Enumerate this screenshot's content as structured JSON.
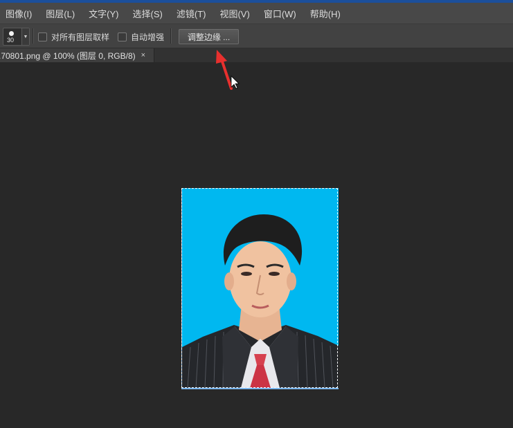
{
  "menubar": {
    "items": [
      "图像(I)",
      "图层(L)",
      "文字(Y)",
      "选择(S)",
      "滤镜(T)",
      "视图(V)",
      "窗口(W)",
      "帮助(H)"
    ]
  },
  "options": {
    "brush_size": "30",
    "sample_all_layers": "对所有图层取样",
    "auto_enhance": "自动增强",
    "refine_edge": "调整边缘 ..."
  },
  "document": {
    "tab_title": ".70801.png @ 100% (图层 0, RGB/8)",
    "close_glyph": "×"
  },
  "colors": {
    "accent": "#1b4f9b",
    "photo_background": "#00b8f0",
    "annotation_arrow": "#e8302e"
  },
  "icons": {
    "brush": "brush-preset-icon",
    "dropdown": "chevron-down-icon",
    "cursor": "mouse-pointer-icon",
    "annotation": "red-arrow-icon"
  }
}
